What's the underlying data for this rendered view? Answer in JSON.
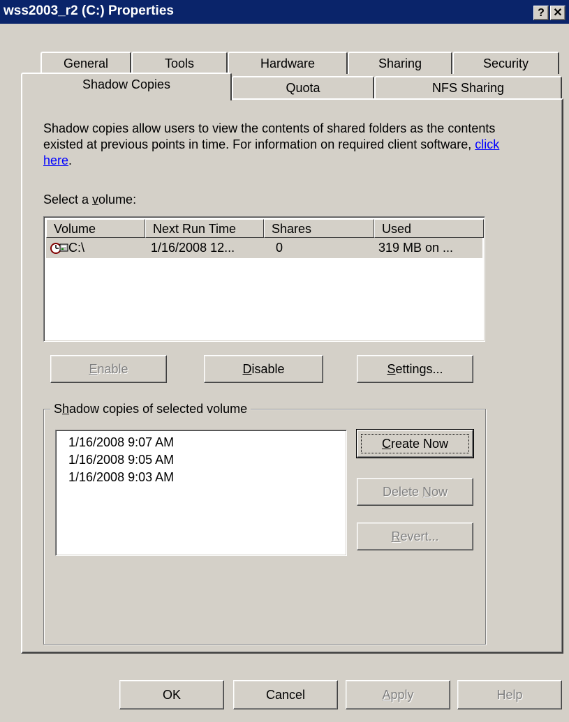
{
  "window": {
    "title": "wss2003_r2 (C:) Properties",
    "help_glyph": "?",
    "close_glyph": "✕"
  },
  "tabs": {
    "row1": [
      "General",
      "Tools",
      "Hardware",
      "Sharing",
      "Security"
    ],
    "row2": [
      "Shadow Copies",
      "Quota",
      "NFS Sharing"
    ],
    "active": "Shadow Copies"
  },
  "description": {
    "text": "Shadow copies allow users to view the contents of shared folders as the contents existed at previous points in time. For information on required client software, ",
    "link": "click here",
    "end": "."
  },
  "volume_section": {
    "label_prefix": "Select a ",
    "label_accel": "v",
    "label_suffix": "olume:",
    "columns": [
      "Volume",
      "Next Run Time",
      "Shares",
      "Used"
    ],
    "rows": [
      {
        "icon": "clock-drive-icon",
        "volume": "C:\\",
        "next_run": "1/16/2008 12...",
        "shares": "0",
        "used": "319 MB on ..."
      }
    ]
  },
  "buttons": {
    "enable": {
      "accel": "E",
      "rest": "nable"
    },
    "disable": {
      "accel": "D",
      "rest": "isable"
    },
    "settings": {
      "accel": "S",
      "rest": "ettings..."
    },
    "create_now": {
      "accel": "C",
      "rest": "reate Now"
    },
    "delete_now": {
      "before": "Delete ",
      "accel": "N",
      "rest": "ow"
    },
    "revert": {
      "accel": "R",
      "rest": "evert..."
    }
  },
  "shadow_group": {
    "label_before": "S",
    "label_accel": "h",
    "label_after": "adow copies of selected volume",
    "items": [
      "1/16/2008 9:07 AM",
      "1/16/2008 9:05 AM",
      "1/16/2008 9:03 AM"
    ]
  },
  "footer": {
    "ok": "OK",
    "cancel": "Cancel",
    "apply": {
      "accel": "A",
      "rest": "pply"
    },
    "help": "Help"
  },
  "colors": {
    "title_bar": "#0a246a",
    "dialog_face": "#d4d0c8",
    "link": "#0000ff"
  }
}
